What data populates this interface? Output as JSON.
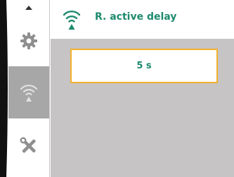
{
  "colors": {
    "accent": "#1e8a6e",
    "highlight_border": "#f2b12b",
    "selected_rail": "#a7a7a7",
    "content_background": "#c6c4c4"
  },
  "rail": {
    "scroll_up_icon": "chevron-up-icon",
    "items": [
      {
        "icon": "gear-icon",
        "selected": false
      },
      {
        "icon": "remote-signal-icon",
        "selected": true
      },
      {
        "icon": "tools-icon",
        "selected": false
      }
    ]
  },
  "header": {
    "icon": "remote-signal-icon",
    "title": "R. active delay"
  },
  "setting": {
    "value": "5 s"
  }
}
